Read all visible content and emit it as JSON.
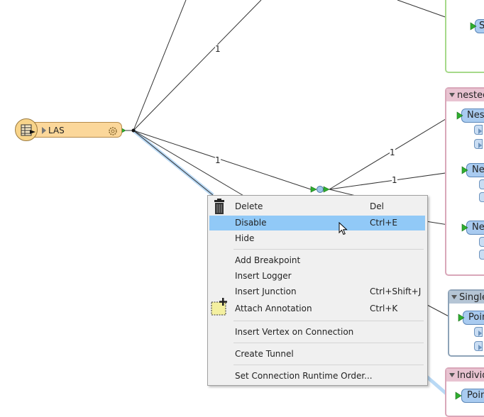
{
  "canvas": {
    "reader": {
      "label": "LAS"
    },
    "connection_counts": [
      "1",
      "1",
      "1",
      "1"
    ],
    "bookmarks": [
      {
        "title": "nested",
        "border_color": "#d9a7b9",
        "header_color": "#e8c3d1"
      },
      {
        "title": "Single",
        "border_color": "#8ea3b8",
        "header_color": "#b5c5d5"
      },
      {
        "title": "Individ",
        "border_color": "#d9a7b9",
        "header_color": "#e8c3d1"
      }
    ],
    "top_bookmark": {
      "border_color": "#a6d98a"
    },
    "transformer_labels": [
      "S",
      "Nest",
      "Ne",
      "Ne",
      "Poin",
      "Poin"
    ]
  },
  "context_menu": {
    "items": [
      {
        "label": "Delete",
        "shortcut": "Del",
        "icon": "trash-icon"
      },
      {
        "label": "Disable",
        "shortcut": "Ctrl+E",
        "highlighted": true
      },
      {
        "label": "Hide",
        "shortcut": ""
      },
      {
        "label": "Add Breakpoint",
        "shortcut": ""
      },
      {
        "label": "Insert Logger",
        "shortcut": ""
      },
      {
        "label": "Insert Junction",
        "shortcut": "Ctrl+Shift+J"
      },
      {
        "label": "Attach Annotation",
        "shortcut": "Ctrl+K",
        "icon": "annotation-icon"
      },
      {
        "label": "Insert Vertex on Connection",
        "shortcut": ""
      },
      {
        "label": "Create Tunnel",
        "shortcut": ""
      },
      {
        "label": "Set Connection Runtime Order...",
        "shortcut": ""
      }
    ]
  },
  "colors": {
    "highlight": "#91c9f7",
    "transformer_fill": "#a9cbf0",
    "reader_fill": "#fbd79a",
    "port_green": "#2fae2f"
  }
}
